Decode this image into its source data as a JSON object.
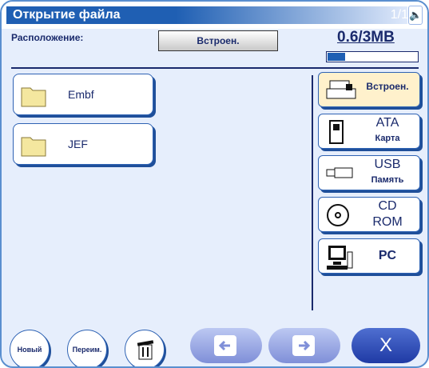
{
  "titlebar": {
    "title": "Открытие файла",
    "page": "1/1",
    "speaker_icon": "speaker-icon"
  },
  "location": {
    "label": "Расположение:",
    "value": "Встроен."
  },
  "capacity": {
    "text": "0.6/3MB",
    "used_fraction": 0.2
  },
  "folders": [
    {
      "name": "Embf",
      "icon": "folder-icon"
    },
    {
      "name": "JEF",
      "icon": "folder-icon"
    }
  ],
  "devices": [
    {
      "id": "builtin",
      "line1": "Встроен.",
      "line2": "",
      "icon": "sewing-machine-icon",
      "selected": true
    },
    {
      "id": "ata",
      "line1": "ATA",
      "line2": "Карта",
      "icon": "card-icon",
      "selected": false
    },
    {
      "id": "usb",
      "line1": "USB",
      "line2": "Память",
      "icon": "usb-stick-icon",
      "selected": false
    },
    {
      "id": "cd",
      "line1": "CD",
      "line2": "ROM",
      "icon": "cd-icon",
      "selected": false
    },
    {
      "id": "pc",
      "line1": "PC",
      "line2": "",
      "icon": "pc-icon",
      "selected": false
    }
  ],
  "bottom": {
    "new_label": "Новый",
    "rename_label": "Переим.",
    "delete_icon": "trash-icon",
    "prev_icon": "arrow-left-icon",
    "next_icon": "arrow-right-icon",
    "close_label": "X"
  },
  "colors": {
    "accent": "#1f5fb3",
    "frame": "#5a8fcf",
    "selected_device": "#fff1cc"
  }
}
